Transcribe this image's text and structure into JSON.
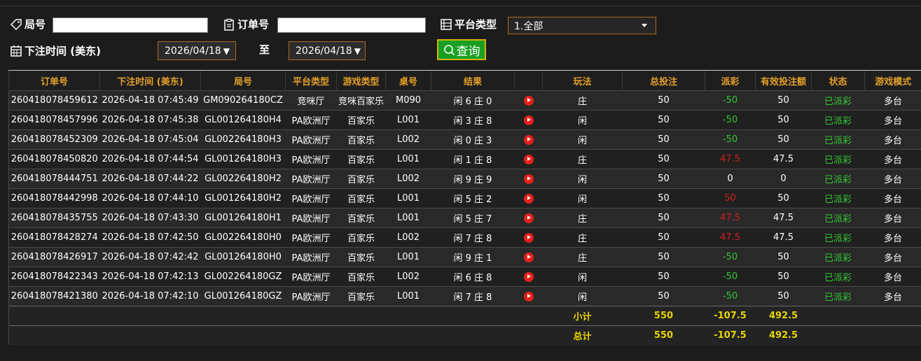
{
  "filters": {
    "round_label": "局号",
    "round_value": "",
    "order_label": "订单号",
    "order_value": "",
    "platform_label": "平台类型",
    "platform_selected": "1.全部",
    "bet_time_label": "下注时间 (美东)",
    "date_from": "2026/04/18",
    "to_label": "至",
    "date_to": "2026/04/18",
    "query_button": "查询"
  },
  "table": {
    "headers": [
      "订单号",
      "下注时间 (美东)",
      "局号",
      "平台类型",
      "游戏类型",
      "桌号",
      "结果",
      "",
      "玩法",
      "总投注",
      "派彩",
      "有效投注额",
      "状态",
      "游戏模式"
    ],
    "rows": [
      {
        "order": "260418078459612",
        "time": "2026-04-18 07:45:49",
        "round": "GM090264180CZ",
        "platform": "竞咪厅",
        "game": "竞咪百家乐",
        "table": "M090",
        "result": "闲 6 庄 0",
        "play": "庄",
        "bet": "50",
        "payout": "-50",
        "payout_type": "win",
        "valid": "50",
        "status": "已派彩",
        "mode": "多台"
      },
      {
        "order": "260418078457996",
        "time": "2026-04-18 07:45:38",
        "round": "GL001264180H4",
        "platform": "PA欧洲厅",
        "game": "百家乐",
        "table": "L001",
        "result": "闲 3 庄 8",
        "play": "闲",
        "bet": "50",
        "payout": "-50",
        "payout_type": "win",
        "valid": "50",
        "status": "已派彩",
        "mode": "多台"
      },
      {
        "order": "260418078452309",
        "time": "2026-04-18 07:45:04",
        "round": "GL002264180H3",
        "platform": "PA欧洲厅",
        "game": "百家乐",
        "table": "L002",
        "result": "闲 0 庄 3",
        "play": "闲",
        "bet": "50",
        "payout": "-50",
        "payout_type": "win",
        "valid": "50",
        "status": "已派彩",
        "mode": "多台"
      },
      {
        "order": "260418078450820",
        "time": "2026-04-18 07:44:54",
        "round": "GL001264180H3",
        "platform": "PA欧洲厅",
        "game": "百家乐",
        "table": "L001",
        "result": "闲 1 庄 8",
        "play": "庄",
        "bet": "50",
        "payout": "47.5",
        "payout_type": "lose",
        "valid": "47.5",
        "status": "已派彩",
        "mode": "多台"
      },
      {
        "order": "260418078444751",
        "time": "2026-04-18 07:44:22",
        "round": "GL002264180H2",
        "platform": "PA欧洲厅",
        "game": "百家乐",
        "table": "L002",
        "result": "闲 9 庄 9",
        "play": "闲",
        "bet": "50",
        "payout": "0",
        "payout_type": "zero",
        "valid": "0",
        "status": "已派彩",
        "mode": "多台"
      },
      {
        "order": "260418078442998",
        "time": "2026-04-18 07:44:10",
        "round": "GL001264180H2",
        "platform": "PA欧洲厅",
        "game": "百家乐",
        "table": "L001",
        "result": "闲 5 庄 2",
        "play": "闲",
        "bet": "50",
        "payout": "50",
        "payout_type": "lose",
        "valid": "50",
        "status": "已派彩",
        "mode": "多台"
      },
      {
        "order": "260418078435755",
        "time": "2026-04-18 07:43:30",
        "round": "GL001264180H1",
        "platform": "PA欧洲厅",
        "game": "百家乐",
        "table": "L001",
        "result": "闲 5 庄 7",
        "play": "庄",
        "bet": "50",
        "payout": "47.5",
        "payout_type": "lose",
        "valid": "47.5",
        "status": "已派彩",
        "mode": "多台"
      },
      {
        "order": "260418078428274",
        "time": "2026-04-18 07:42:50",
        "round": "GL002264180H0",
        "platform": "PA欧洲厅",
        "game": "百家乐",
        "table": "L002",
        "result": "闲 7 庄 8",
        "play": "庄",
        "bet": "50",
        "payout": "47.5",
        "payout_type": "lose",
        "valid": "47.5",
        "status": "已派彩",
        "mode": "多台"
      },
      {
        "order": "260418078426917",
        "time": "2026-04-18 07:42:42",
        "round": "GL001264180H0",
        "platform": "PA欧洲厅",
        "game": "百家乐",
        "table": "L001",
        "result": "闲 9 庄 1",
        "play": "庄",
        "bet": "50",
        "payout": "-50",
        "payout_type": "win",
        "valid": "50",
        "status": "已派彩",
        "mode": "多台"
      },
      {
        "order": "260418078422343",
        "time": "2026-04-18 07:42:13",
        "round": "GL002264180GZ",
        "platform": "PA欧洲厅",
        "game": "百家乐",
        "table": "L002",
        "result": "闲 6 庄 8",
        "play": "闲",
        "bet": "50",
        "payout": "-50",
        "payout_type": "win",
        "valid": "50",
        "status": "已派彩",
        "mode": "多台"
      },
      {
        "order": "260418078421380",
        "time": "2026-04-18 07:42:10",
        "round": "GL001264180GZ",
        "platform": "PA欧洲厅",
        "game": "百家乐",
        "table": "L001",
        "result": "闲 7 庄 8",
        "play": "闲",
        "bet": "50",
        "payout": "-50",
        "payout_type": "win",
        "valid": "50",
        "status": "已派彩",
        "mode": "多台"
      }
    ],
    "subtotal": {
      "label": "小计",
      "bet": "550",
      "payout": "-107.5",
      "valid": "492.5"
    },
    "total": {
      "label": "总计",
      "bet": "550",
      "payout": "-107.5",
      "valid": "492.5"
    }
  },
  "colors": {
    "header_text": "#e4a02a",
    "win": "#34c634",
    "lose": "#d21e1e",
    "sum": "#e8d400",
    "button": "#19a023"
  }
}
